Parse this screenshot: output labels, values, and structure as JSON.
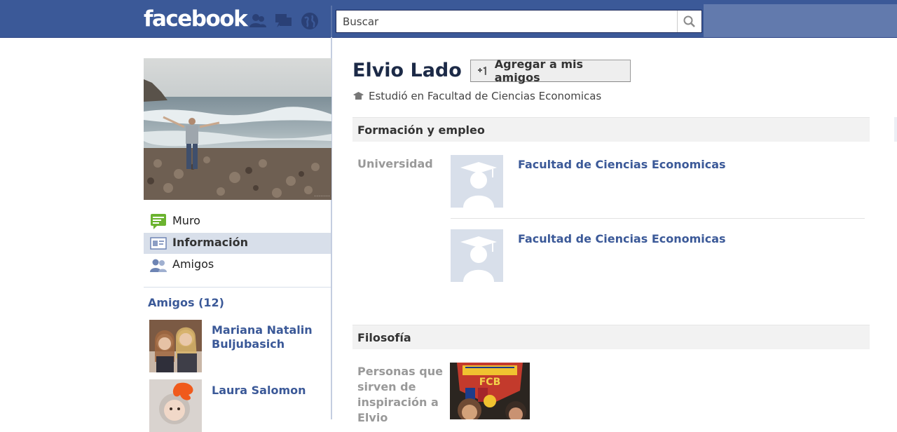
{
  "header": {
    "logo": "facebook",
    "search": {
      "placeholder": "Buscar",
      "value": ""
    },
    "jewels": [
      "friend-requests-icon",
      "messages-icon",
      "notifications-icon"
    ]
  },
  "colors": {
    "brand": "#3b5998",
    "brand_light": "#627aad",
    "nav_active": "#d8dfea",
    "link": "#3b5998",
    "section_bg": "#f2f2f2"
  },
  "sidebar": {
    "nav": [
      {
        "label": "Muro",
        "icon": "wall-icon",
        "active": false
      },
      {
        "label": "Información",
        "icon": "info-icon",
        "active": true
      },
      {
        "label": "Amigos",
        "icon": "friends-icon",
        "active": false
      }
    ],
    "friends_heading": "Amigos (12)",
    "friends": [
      {
        "name": "Mariana Natalin Buljubasich"
      },
      {
        "name": "Laura Salomon"
      }
    ]
  },
  "profile": {
    "name": "Elvio Lado",
    "add_friend_label": "Agregar a mis amigos",
    "study_line": "Estudió en Facultad de Ciencias Economicas"
  },
  "education": {
    "title": "Formación y empleo",
    "label": "Universidad",
    "schools": [
      {
        "name": "Facultad de Ciencias Economicas"
      },
      {
        "name": "Facultad de Ciencias Economicas"
      }
    ]
  },
  "philosophy": {
    "title": "Filosofía",
    "label": "Personas que sirven de inspiración a Elvio",
    "badge_text": "FCB"
  }
}
